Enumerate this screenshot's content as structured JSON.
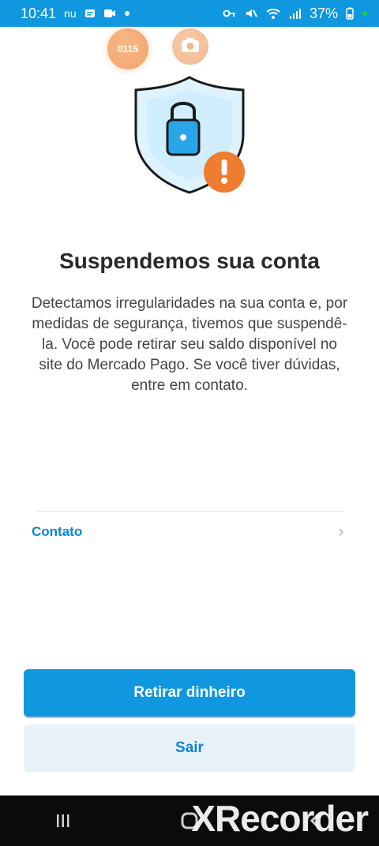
{
  "status_bar": {
    "time": "10:41",
    "left_text": "nu",
    "battery_percent": "37%"
  },
  "badges": {
    "orange_text": "0115"
  },
  "content": {
    "title": "Suspendemos sua conta",
    "message": "Detectamos irregularidades na sua conta e, por medidas de segurança, tivemos que suspendê-la. Você pode retirar seu saldo disponível no site do Mercado Pago. Se você tiver dúvidas, entre em contato."
  },
  "contact": {
    "label": "Contato"
  },
  "buttons": {
    "primary": "Retirar dinheiro",
    "secondary": "Sair"
  },
  "overlay": {
    "watermark": "XRecorder"
  },
  "colors": {
    "accent": "#0f97e0",
    "accent_text": "#0b84d8",
    "warning": "#f07c2f"
  }
}
